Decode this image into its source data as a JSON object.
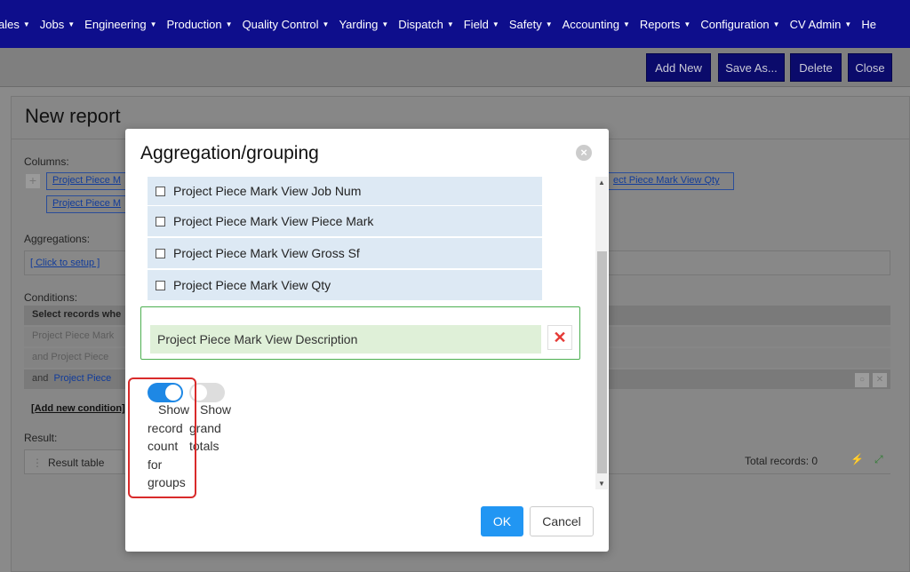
{
  "nav": {
    "items": [
      "ales",
      "Jobs",
      "Engineering",
      "Production",
      "Quality Control",
      "Yarding",
      "Dispatch",
      "Field",
      "Safety",
      "Accounting",
      "Reports",
      "Configuration",
      "CV Admin",
      "He"
    ]
  },
  "toolbar": {
    "add_new": "Add New",
    "save_as": "Save As...",
    "delete": "Delete",
    "close": "Close"
  },
  "page": {
    "title": "New report",
    "columns_label": "Columns:",
    "column_1": "Project Piece M",
    "column_2": "Project Piece M",
    "column_right": "ect Piece Mark View Qty",
    "aggregations_label": "Aggregations:",
    "aggregations_link": "[ Click to setup ]",
    "conditions_label": "Conditions:",
    "cond_header": "Select records whe",
    "cond_1": "Project Piece Mark",
    "cond_2": "and  Project Piece",
    "cond_3_prefix": "and",
    "cond_3_link": "Project Piece",
    "add_condition": "[Add new condition]",
    "result_label": "Result:",
    "result_tab": "Result table",
    "total_records": "Total records: 0"
  },
  "modal": {
    "title": "Aggregation/grouping",
    "options": [
      "Project Piece Mark View Job Num",
      "Project Piece Mark View Piece Mark",
      "Project Piece Mark View Gross Sf",
      "Project Piece Mark View Qty"
    ],
    "group_by_item": "Project Piece Mark View Description",
    "remove_symbol": "✕",
    "show_record_count": {
      "label_lines": [
        "Show",
        "record",
        "count",
        "for",
        "groups"
      ],
      "checked": true
    },
    "show_grand_totals": {
      "label_lines": [
        "Show",
        "grand",
        "totals"
      ],
      "checked": false
    },
    "ok": "OK",
    "cancel": "Cancel"
  }
}
